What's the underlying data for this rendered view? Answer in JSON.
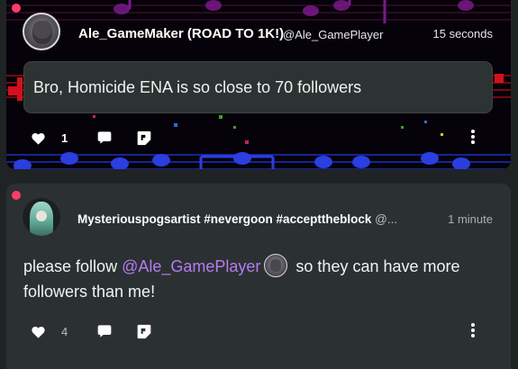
{
  "posts": [
    {
      "author": "Ale_GameMaker (ROAD TO 1K!)",
      "handle": "@Ale_GamePlayer",
      "time": "15 seconds",
      "text": "Bro, Homicide ENA is so close to 70 followers",
      "likes": "1",
      "unread": true
    },
    {
      "author": "Mysteriouspogsartist #nevergoon #accepttheblock",
      "handle": "@...",
      "time": "1 minute",
      "text_before": "please follow ",
      "mention": "@Ale_GamePlayer",
      "text_after": " so they can have more followers than me!",
      "likes": "4",
      "unread": true
    }
  ],
  "icons": {
    "like": "heart-icon",
    "reply": "speech-bubble-icon",
    "remix": "remix-icon",
    "more": "vertical-dots-icon"
  },
  "colors": {
    "background": "#1f2324",
    "card": "#2b3132",
    "unread_dot": "#ff3b6e",
    "mention": "#b77bf2",
    "text": "#f1f3f3"
  }
}
